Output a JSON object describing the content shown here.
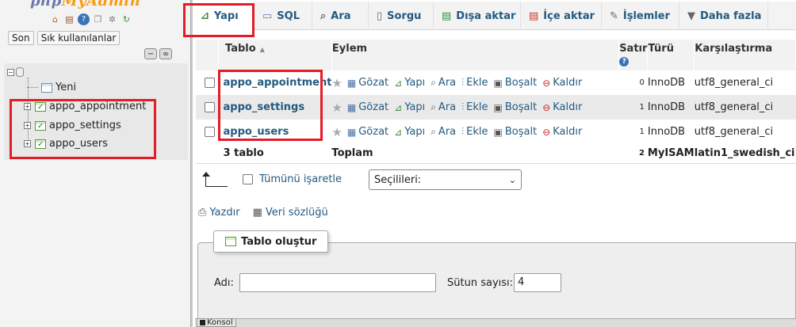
{
  "nav": {
    "logo_php": "php",
    "logo_myadmin": "MyAdmin",
    "buttons": [
      "Son",
      "Sık kullanılanlar"
    ],
    "tree": {
      "new_label": "Yeni",
      "tables": [
        "appo_appointment",
        "appo_settings",
        "appo_users"
      ]
    }
  },
  "tabs": [
    {
      "label": "Yapı",
      "icon": "structure-icon"
    },
    {
      "label": "SQL",
      "icon": "sql-icon"
    },
    {
      "label": "Ara",
      "icon": "search-icon"
    },
    {
      "label": "Sorgu",
      "icon": "query-icon"
    },
    {
      "label": "Dışa aktar",
      "icon": "export-icon"
    },
    {
      "label": "İçe aktar",
      "icon": "import-icon"
    },
    {
      "label": "İşlemler",
      "icon": "wrench-icon"
    },
    {
      "label": "Daha fazla",
      "icon": "caret-down-icon"
    }
  ],
  "table": {
    "headers": {
      "table": "Tablo",
      "action": "Eylem",
      "rows": "Satır",
      "type": "Türü",
      "collation": "Karşılaştırma"
    },
    "actions": [
      "Gözat",
      "Yapı",
      "Ara",
      "Ekle",
      "Boşalt",
      "Kaldır"
    ],
    "rows": [
      {
        "name": "appo_appointment",
        "rows": "0",
        "type": "InnoDB",
        "collation": "utf8_general_ci"
      },
      {
        "name": "appo_settings",
        "rows": "1",
        "type": "InnoDB",
        "collation": "utf8_general_ci"
      },
      {
        "name": "appo_users",
        "rows": "1",
        "type": "InnoDB",
        "collation": "utf8_general_ci"
      }
    ],
    "footer": {
      "count": "3 tablo",
      "total": "Toplam",
      "rows": "2",
      "type": "MyISAM",
      "collation": "latin1_swedish_ci"
    }
  },
  "bulk": {
    "check_all": "Tümünü işaretle",
    "with_selected": "Seçilileri:"
  },
  "links": {
    "print": "Yazdır",
    "data_dictionary": "Veri sözlüğü"
  },
  "create_table": {
    "legend": "Tablo oluştur",
    "name_label": "Adı:",
    "name_value": "",
    "columns_label": "Sütun sayısı:",
    "columns_value": "4"
  },
  "console": {
    "label": "Konsol"
  },
  "colors": {
    "link": "#235a81",
    "highlight": "#e31c25"
  }
}
